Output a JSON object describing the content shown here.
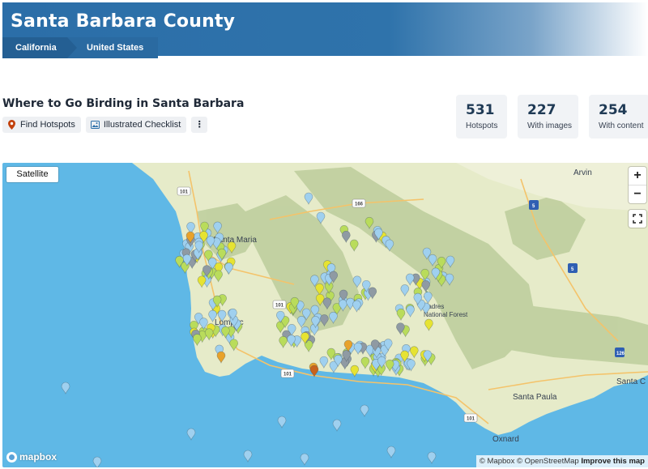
{
  "header": {
    "title": "Santa Barbara County",
    "breadcrumbs": [
      "California",
      "United States"
    ]
  },
  "section": {
    "title": "Where to Go Birding in Santa Barbara",
    "actions": {
      "find_hotspots": "Find Hotspots",
      "checklist": "Illustrated Checklist",
      "more": "⋮"
    }
  },
  "stats": [
    {
      "value": "531",
      "label": "Hotspots"
    },
    {
      "value": "227",
      "label": "With images"
    },
    {
      "value": "254",
      "label": "With content"
    }
  ],
  "map": {
    "satellite_label": "Satellite",
    "zoom_in": "+",
    "zoom_out": "−",
    "logo_text": "mapbox",
    "attribution_a": "© Mapbox © OpenStreetMap",
    "attribution_b": "Improve this map",
    "place_labels": {
      "arvin": "Arvin",
      "santa_maria": "Santa Maria",
      "padres_1": "Padres",
      "padres_2": "National Forest",
      "lompoc": "Lompoc",
      "santa_paula": "Santa Paula",
      "santa_clarita": "Santa C",
      "oxnard": "Oxnard"
    },
    "road_labels": {
      "r101_a": "101",
      "r166": "166",
      "r101_b": "101",
      "r101_c": "101",
      "r101_d": "101",
      "i5": "5",
      "i5b": "5",
      "r126": "126"
    },
    "colors": {
      "ocean": "#5fb8e6",
      "land": "#e6ebc9",
      "mountain": "#bfcf9e",
      "pin_blue": "#9fd0ef",
      "pin_gray": "#8f9aa3",
      "pin_lime": "#b9dc5b",
      "pin_yellow": "#e6e332",
      "pin_orange": "#e8a22a",
      "pin_red": "#c8621d"
    }
  }
}
